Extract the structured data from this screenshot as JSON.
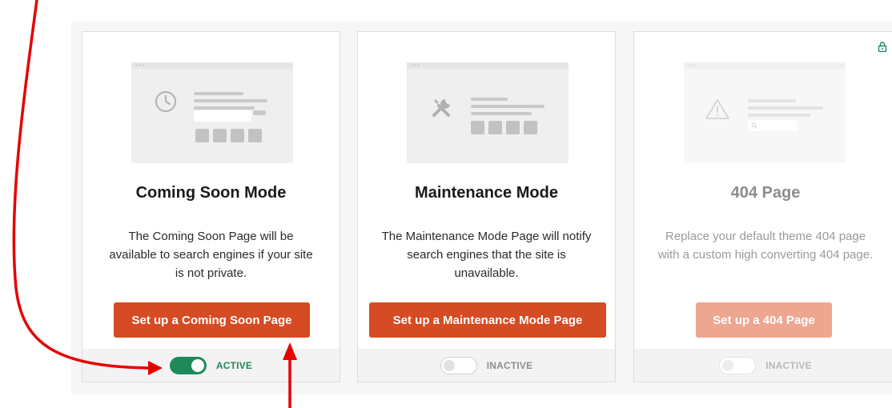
{
  "cards": [
    {
      "title": "Coming Soon Mode",
      "description": "The Coming Soon Page will be available to search engines if your site is not private.",
      "button_label": "Set up a Coming Soon Page",
      "toggle_state": "on",
      "status_label": "ACTIVE",
      "icon": "clock-icon"
    },
    {
      "title": "Maintenance Mode",
      "description": "The Maintenance Mode Page will notify search engines that the site is unavailable.",
      "button_label": "Set up a Maintenance Mode Page",
      "toggle_state": "off",
      "status_label": "INACTIVE",
      "icon": "tools-icon"
    },
    {
      "title": "404 Page",
      "description": "Replace your default theme 404 page with a custom high converting 404 page.",
      "button_label": "Set up a 404 Page",
      "toggle_state": "off",
      "status_label": "INACTIVE",
      "icon": "warning-icon",
      "locked": true,
      "lock_icon": "lock-icon"
    }
  ],
  "colors": {
    "accent": "#d54b23",
    "accent_disabled": "#eda690",
    "active_green": "#1e8a5a",
    "annotation_red": "#e60000"
  }
}
